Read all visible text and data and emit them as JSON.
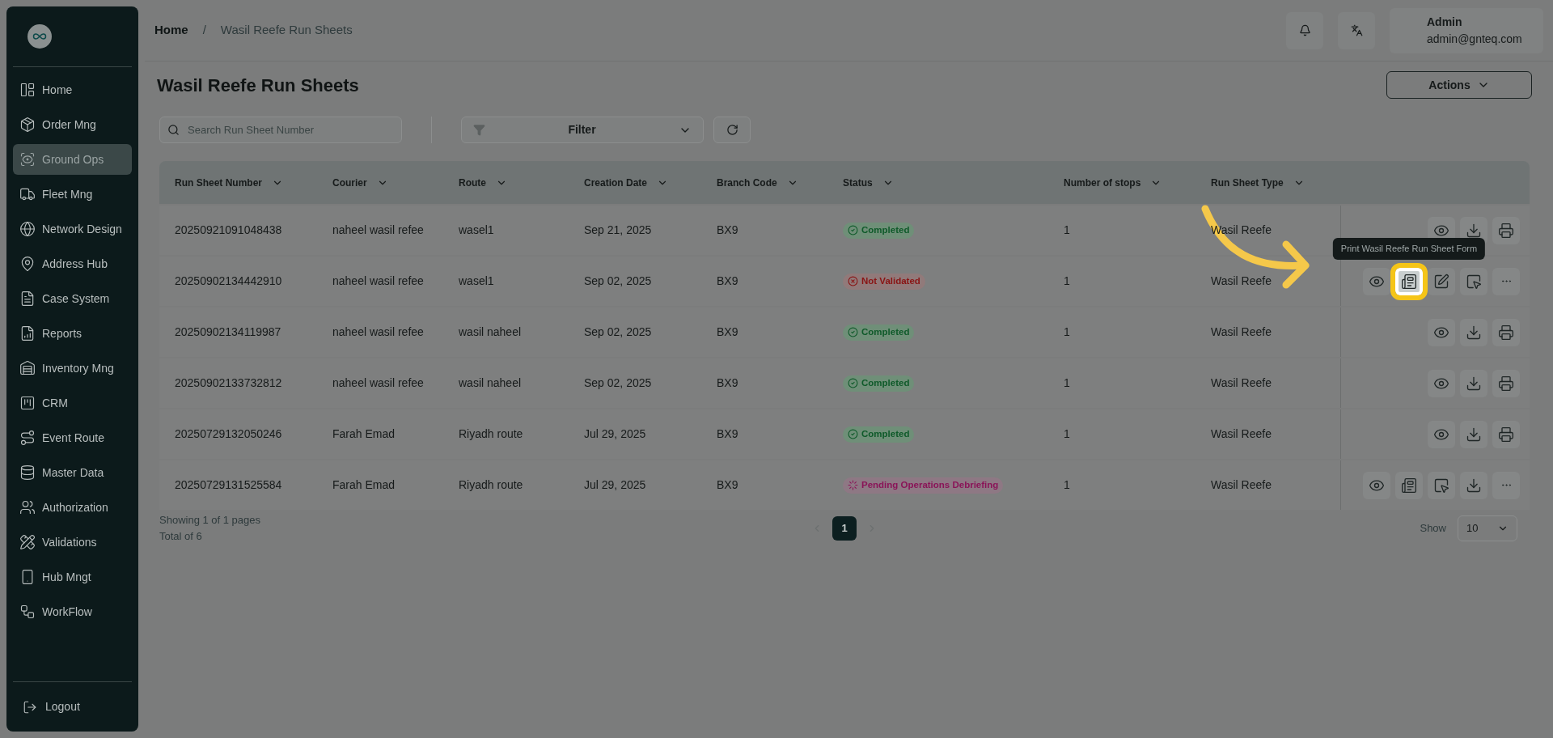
{
  "sidebar": {
    "items": [
      {
        "label": "Home",
        "selected": false
      },
      {
        "label": "Order Mng",
        "selected": false
      },
      {
        "label": "Ground Ops",
        "selected": true
      },
      {
        "label": "Fleet Mng",
        "selected": false
      },
      {
        "label": "Network Design",
        "selected": false
      },
      {
        "label": "Address Hub",
        "selected": false
      },
      {
        "label": "Case System",
        "selected": false
      },
      {
        "label": "Reports",
        "selected": false
      },
      {
        "label": "Inventory Mng",
        "selected": false
      },
      {
        "label": "CRM",
        "selected": false
      },
      {
        "label": "Event Route",
        "selected": false
      },
      {
        "label": "Master Data",
        "selected": false
      },
      {
        "label": "Authorization",
        "selected": false
      },
      {
        "label": "Validations",
        "selected": false
      },
      {
        "label": "Hub Mngt",
        "selected": false
      },
      {
        "label": "WorkFlow",
        "selected": false
      }
    ],
    "logout": "Logout"
  },
  "breadcrumb": [
    "Home",
    "/",
    "Wasil Reefe Run Sheets"
  ],
  "user": {
    "name": "Admin",
    "email": "admin@gnteq.com"
  },
  "page_title": "Wasil Reefe Run Sheets",
  "actions_button": "Actions",
  "search": {
    "placeholder": "Search Run Sheet Number"
  },
  "filter": "Filter",
  "table": {
    "columns": [
      "Run Sheet Number",
      "Courier",
      "Route",
      "Creation Date",
      "Branch Code",
      "Status",
      "Number of stops",
      "Run Sheet Type"
    ],
    "rows": [
      {
        "cells": [
          "20250921091048438",
          "naheel wasil refee",
          "wasel1",
          "Sep 21, 2025",
          "BX9"
        ],
        "status": {
          "kind": "completed",
          "label": "Completed"
        },
        "stops": "1",
        "type": "Wasil Reefe",
        "actions": [
          {
            "kind": "view",
            "highlighted": false
          },
          {
            "kind": "download",
            "highlighted": false
          },
          {
            "kind": "print",
            "highlighted": false
          }
        ]
      },
      {
        "cells": [
          "20250902134442910",
          "naheel wasil refee",
          "wasel1",
          "Sep 02, 2025",
          "BX9"
        ],
        "status": {
          "kind": "not_validated",
          "label": "Not Validated"
        },
        "stops": "1",
        "type": "Wasil Reefe",
        "actions": [
          {
            "kind": "view",
            "highlighted": false
          },
          {
            "kind": "form",
            "highlighted": true,
            "tooltip": "Print Wasil Reefe Run Sheet Form"
          },
          {
            "kind": "edit",
            "highlighted": false
          },
          {
            "kind": "select",
            "highlighted": false
          },
          {
            "kind": "more",
            "highlighted": false
          }
        ]
      },
      {
        "cells": [
          "20250902134119987",
          "naheel wasil refee",
          "wasil naheel",
          "Sep 02, 2025",
          "BX9"
        ],
        "status": {
          "kind": "completed",
          "label": "Completed"
        },
        "stops": "1",
        "type": "Wasil Reefe",
        "actions": [
          {
            "kind": "view",
            "highlighted": false
          },
          {
            "kind": "download",
            "highlighted": false
          },
          {
            "kind": "print",
            "highlighted": false
          }
        ]
      },
      {
        "cells": [
          "20250902133732812",
          "naheel wasil refee",
          "wasil naheel",
          "Sep 02, 2025",
          "BX9"
        ],
        "status": {
          "kind": "completed",
          "label": "Completed"
        },
        "stops": "1",
        "type": "Wasil Reefe",
        "actions": [
          {
            "kind": "view",
            "highlighted": false
          },
          {
            "kind": "download",
            "highlighted": false
          },
          {
            "kind": "print",
            "highlighted": false
          }
        ]
      },
      {
        "cells": [
          "20250729132050246",
          "Farah Emad",
          "Riyadh route",
          "Jul 29, 2025",
          "BX9"
        ],
        "status": {
          "kind": "completed",
          "label": "Completed"
        },
        "stops": "1",
        "type": "Wasil Reefe",
        "actions": [
          {
            "kind": "view",
            "highlighted": false
          },
          {
            "kind": "download",
            "highlighted": false
          },
          {
            "kind": "print",
            "highlighted": false
          }
        ]
      },
      {
        "cells": [
          "20250729131525584",
          "Farah Emad",
          "Riyadh route",
          "Jul 29, 2025",
          "BX9"
        ],
        "status": {
          "kind": "pending",
          "label": "Pending Operations Debriefing"
        },
        "stops": "1",
        "type": "Wasil Reefe",
        "actions": [
          {
            "kind": "view",
            "highlighted": false
          },
          {
            "kind": "form",
            "highlighted": false
          },
          {
            "kind": "select",
            "highlighted": false
          },
          {
            "kind": "download",
            "highlighted": false
          },
          {
            "kind": "more",
            "highlighted": false
          }
        ]
      }
    ]
  },
  "pagination": {
    "showing": "Showing 1 of 1 pages",
    "total": "Total of 6",
    "pages": [
      {
        "label": "1",
        "selected": true
      }
    ],
    "show_label": "Show",
    "page_size": "10"
  }
}
